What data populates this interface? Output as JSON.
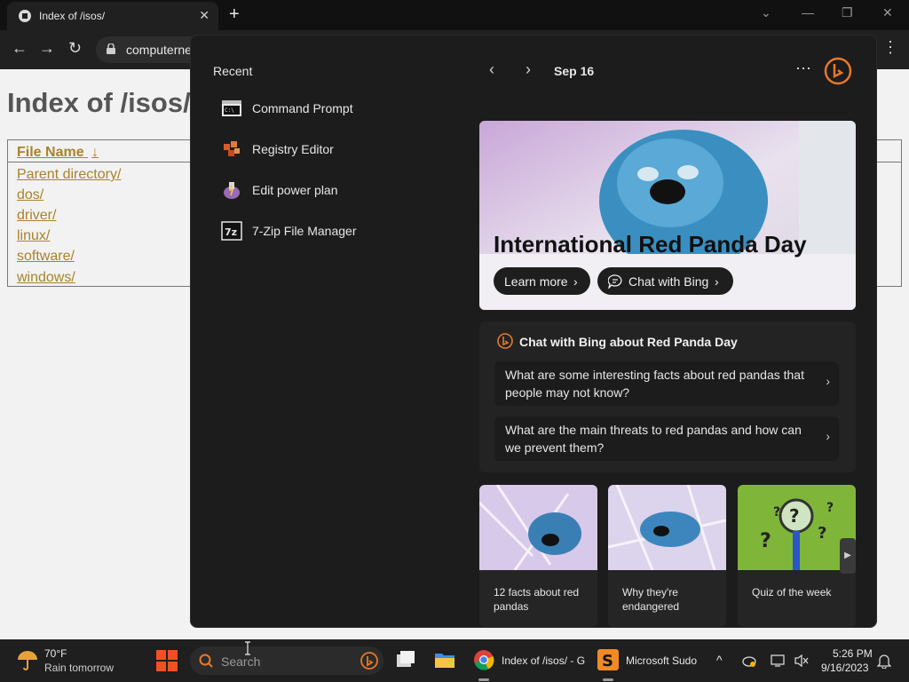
{
  "browser": {
    "tab_title": "Index of /isos/",
    "tab_close": "✕",
    "new_tab": "+",
    "url": "computerne",
    "controls": {
      "dropdown": "⌄",
      "minimize": "—",
      "restore": "❐",
      "close": "✕"
    },
    "nav": {
      "back": "←",
      "forward": "→",
      "reload": "↻",
      "menu": "⋮"
    }
  },
  "page": {
    "heading": "Index of /isos/",
    "column_header": "File Name",
    "sort_indicator": "↓",
    "entries": [
      "Parent directory/",
      "dos/",
      "driver/",
      "linux/",
      "software/",
      "windows/"
    ]
  },
  "widgets": {
    "recent_title": "Recent",
    "recent_items": [
      {
        "label": "Command Prompt",
        "icon": "command-prompt-icon"
      },
      {
        "label": "Registry Editor",
        "icon": "registry-editor-icon"
      },
      {
        "label": "Edit power plan",
        "icon": "power-plan-icon"
      },
      {
        "label": "7-Zip File Manager",
        "icon": "7zip-icon"
      }
    ],
    "date": "Sep 16",
    "prev": "‹",
    "next": "›",
    "more": "···",
    "hero": {
      "title": "International Red Panda Day",
      "learn_more": "Learn more",
      "chat_with_bing": "Chat with Bing",
      "chevron": "›"
    },
    "chat_card": {
      "title": "Chat with Bing about Red Panda Day",
      "questions": [
        "What are some interesting facts about red pandas that people may not know?",
        "What are the main threats to red pandas and how can we prevent them?"
      ],
      "chevron": "›"
    },
    "tiles": [
      {
        "caption": "12 facts about red pandas"
      },
      {
        "caption": "Why they're endangered"
      },
      {
        "caption": "Quiz of the week"
      }
    ],
    "scroll_next": "▶"
  },
  "taskbar": {
    "weather_temp": "70°F",
    "weather_desc": "Rain tomorrow",
    "search_placeholder": "Search",
    "chrome_label": "Index of /isos/ - G",
    "sudoku_label": "Microsoft Sudo",
    "tray_chevron": "^",
    "time": "5:26 PM",
    "date": "9/16/2023"
  },
  "colors": {
    "link": "#a8832b",
    "panel_bg": "#1c1c1c",
    "taskbar_bg": "#1f1f1f"
  }
}
